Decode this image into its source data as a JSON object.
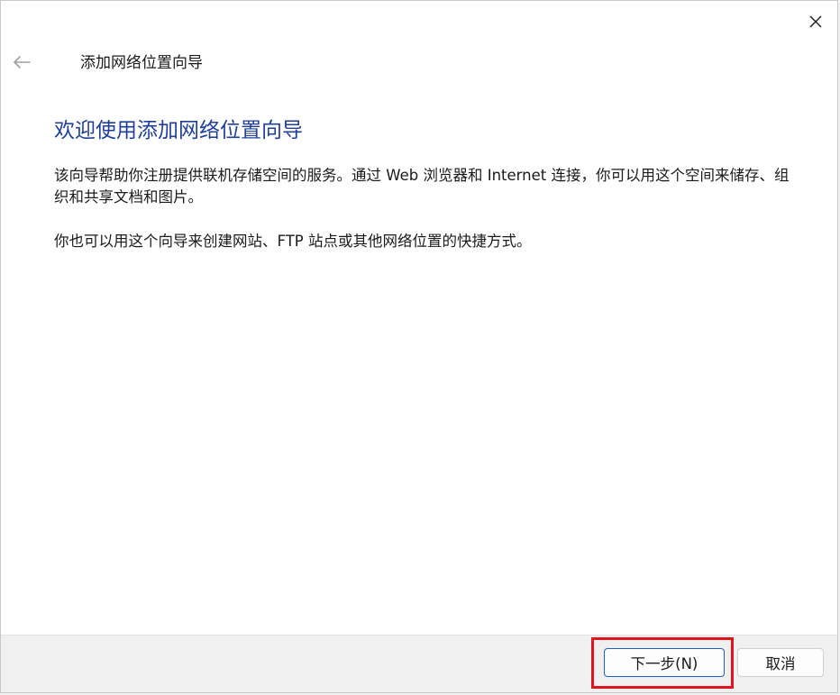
{
  "wizard": {
    "title": "添加网络位置向导",
    "heading": "欢迎使用添加网络位置向导",
    "paragraph1": "该向导帮助你注册提供联机存储空间的服务。通过 Web 浏览器和 Internet 连接，你可以用这个空间来储存、组织和共享文档和图片。",
    "paragraph2": "你也可以用这个向导来创建网站、FTP 站点或其他网络位置的快捷方式。"
  },
  "buttons": {
    "next_label": "下一步(N)",
    "cancel_label": "取消"
  },
  "icons": {
    "back": "back-arrow-icon",
    "close": "close-icon"
  },
  "colors": {
    "heading": "#1e3f9e",
    "highlight": "#e0151f",
    "primary_border": "#1f5fbf"
  }
}
